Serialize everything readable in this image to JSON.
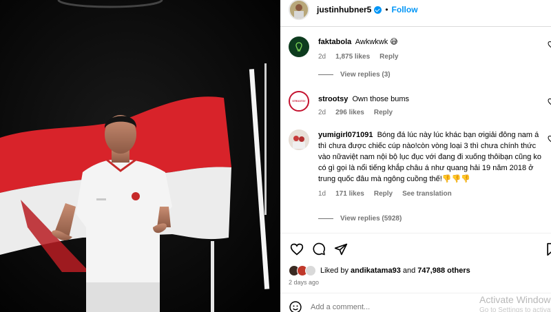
{
  "post": {
    "username": "justinhubner5",
    "follow_label": "Follow",
    "separator": "•"
  },
  "comments": [
    {
      "username": "faktabola",
      "text": "Awkwkwk 😅",
      "time": "2d",
      "likes": "1,875 likes",
      "reply_label": "Reply",
      "avatar_color": "#0d3b1e",
      "view_replies": "View replies (3)"
    },
    {
      "username": "strootsy",
      "text": "Own those bums",
      "time": "2d",
      "likes": "296 likes",
      "reply_label": "Reply",
      "avatar_color": "#c4122f",
      "avatar_text": "STROOTSY"
    },
    {
      "username": "yumigirl071091",
      "text": "Bóng đá lúc này lúc khác bạn ơigiải đông nam á thì chưa được chiếc cúp nào!còn vòng loại 3 thì chưa chính thức vào nữaviệt nam nội bộ lục đục với đang đi xuống thôibạn cũng ko có gì gọi là nổi tiếng khắp châu á như quang hải 19 năm 2018 ở trung quốc đâu mà ngông cuồng thế!👎👎👎",
      "time": "1d",
      "likes": "171 likes",
      "reply_label": "Reply",
      "translation_label": "See translation",
      "avatar_color": "#d9d0c7",
      "view_replies": "View replies (5928)"
    }
  ],
  "likes_summary": {
    "prefix": "Liked by",
    "user": "andikatama93",
    "connector": "and",
    "count": "747,988 others"
  },
  "time_ago": "2 days ago",
  "add_comment_placeholder": "Add a comment...",
  "watermark": {
    "line1": "Activate Windows",
    "line2": "Go to Settings to activate Windows."
  },
  "colors": {
    "accent": "#0095f6",
    "muted": "#737373",
    "flag_red": "#d8232a",
    "flag_white": "#f2f2f2"
  }
}
